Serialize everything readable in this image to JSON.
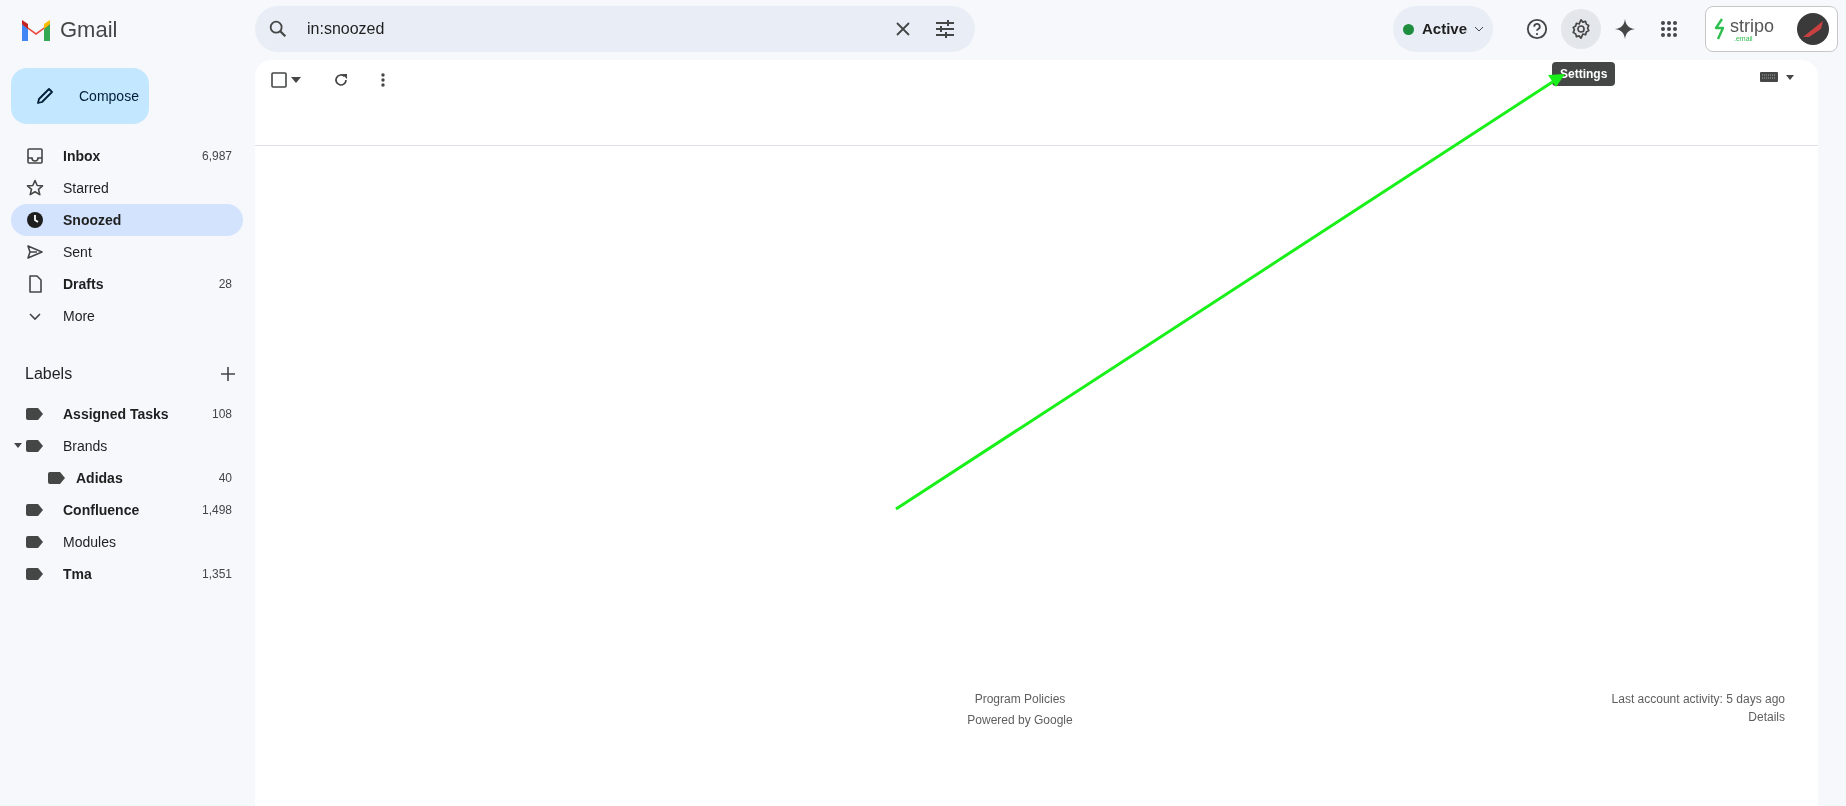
{
  "app": {
    "name": "Gmail"
  },
  "search": {
    "value": "in:snoozed"
  },
  "select_all": {
    "checked": false
  },
  "status": {
    "label": "Active",
    "active": true
  },
  "tooltip": {
    "text": "Settings"
  },
  "account": {
    "brand": "stripo",
    "brand_sub": ".email"
  },
  "compose": {
    "label": "Compose"
  },
  "nav": [
    {
      "label": "Inbox",
      "count": "6,987",
      "unread": true,
      "selected": false
    },
    {
      "label": "Starred",
      "unread": false,
      "selected": false
    },
    {
      "label": "Snoozed",
      "unread": true,
      "selected": true
    },
    {
      "label": "Sent",
      "unread": false,
      "selected": false
    },
    {
      "label": "Drafts",
      "count": "28",
      "unread": true,
      "selected": false
    },
    {
      "label": "More",
      "unread": false,
      "selected": false
    }
  ],
  "labels": {
    "title": "Labels",
    "items": [
      {
        "label": "Assigned Tasks",
        "count": "108",
        "unread": true
      },
      {
        "label": "Brands",
        "unread": false,
        "expanded": true,
        "children": [
          {
            "label": "Adidas",
            "count": "40",
            "unread": true
          }
        ]
      },
      {
        "label": "Confluence",
        "count": "1,498",
        "unread": true
      },
      {
        "label": "Modules",
        "unread": false
      },
      {
        "label": "Tma",
        "count": "1,351",
        "unread": true
      }
    ]
  },
  "footer": {
    "links": [
      "Program Policies",
      "Powered by Google"
    ],
    "activity": "Last account activity: 5 days ago",
    "details": "Details"
  }
}
